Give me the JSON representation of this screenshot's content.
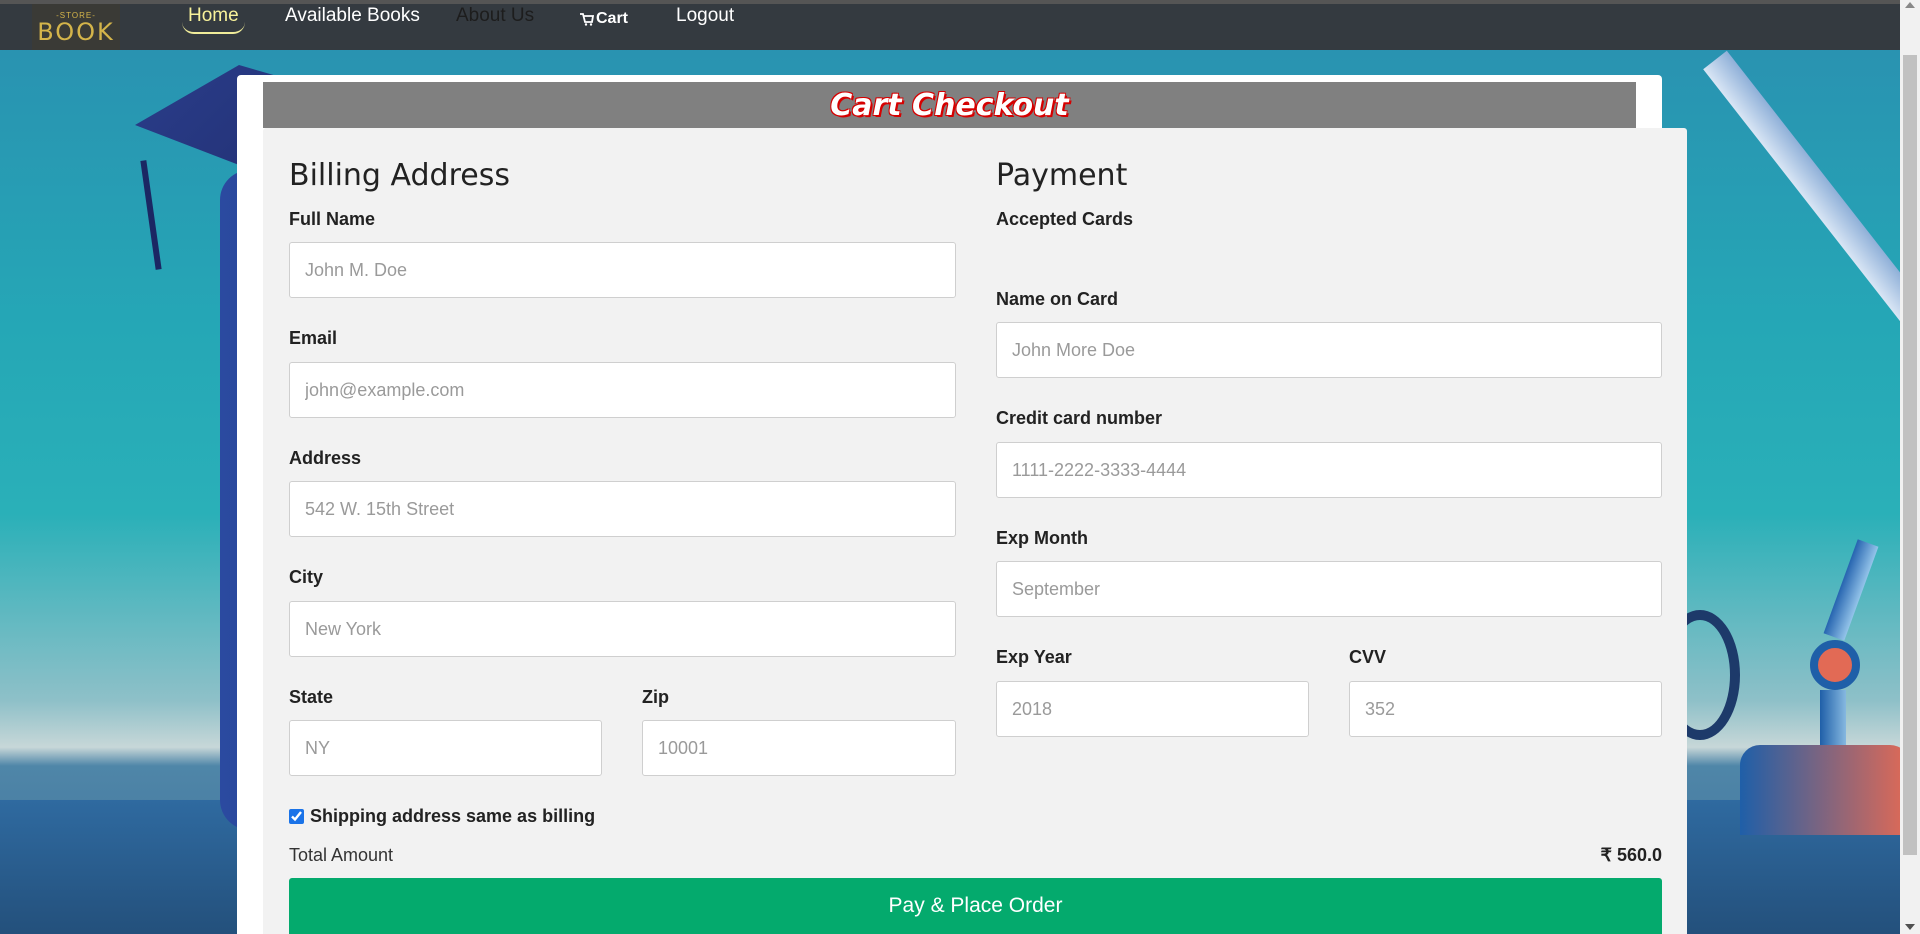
{
  "brand": {
    "top_text": "-STORE-",
    "main_text": "BOOK"
  },
  "nav": {
    "home": "Home",
    "available_books": "Available Books",
    "about_us": "About Us",
    "cart": "Cart",
    "logout": "Logout"
  },
  "header": {
    "title": "Cart Checkout"
  },
  "billing": {
    "title": "Billing Address",
    "full_name": {
      "label": "Full Name",
      "placeholder": "John M. Doe"
    },
    "email": {
      "label": "Email",
      "placeholder": "john@example.com"
    },
    "address": {
      "label": "Address",
      "placeholder": "542 W. 15th Street"
    },
    "city": {
      "label": "City",
      "placeholder": "New York"
    },
    "state": {
      "label": "State",
      "placeholder": "NY"
    },
    "zip": {
      "label": "Zip",
      "placeholder": "10001"
    }
  },
  "payment": {
    "title": "Payment",
    "accepted_cards": "Accepted Cards",
    "name_on_card": {
      "label": "Name on Card",
      "placeholder": "John More Doe"
    },
    "card_number": {
      "label": "Credit card number",
      "placeholder": "1111-2222-3333-4444"
    },
    "exp_month": {
      "label": "Exp Month",
      "placeholder": "September"
    },
    "exp_year": {
      "label": "Exp Year",
      "placeholder": "2018"
    },
    "cvv": {
      "label": "CVV",
      "placeholder": "352"
    }
  },
  "shipping_same": {
    "label": "Shipping address same as billing",
    "checked": true
  },
  "total": {
    "label": "Total Amount",
    "value": "₹ 560.0"
  },
  "pay_button": "Pay & Place Order",
  "colors": {
    "navbar": "#343a40",
    "header": "#808080",
    "pay_button": "#04aa6d",
    "active_nav": "#f8f29a"
  }
}
